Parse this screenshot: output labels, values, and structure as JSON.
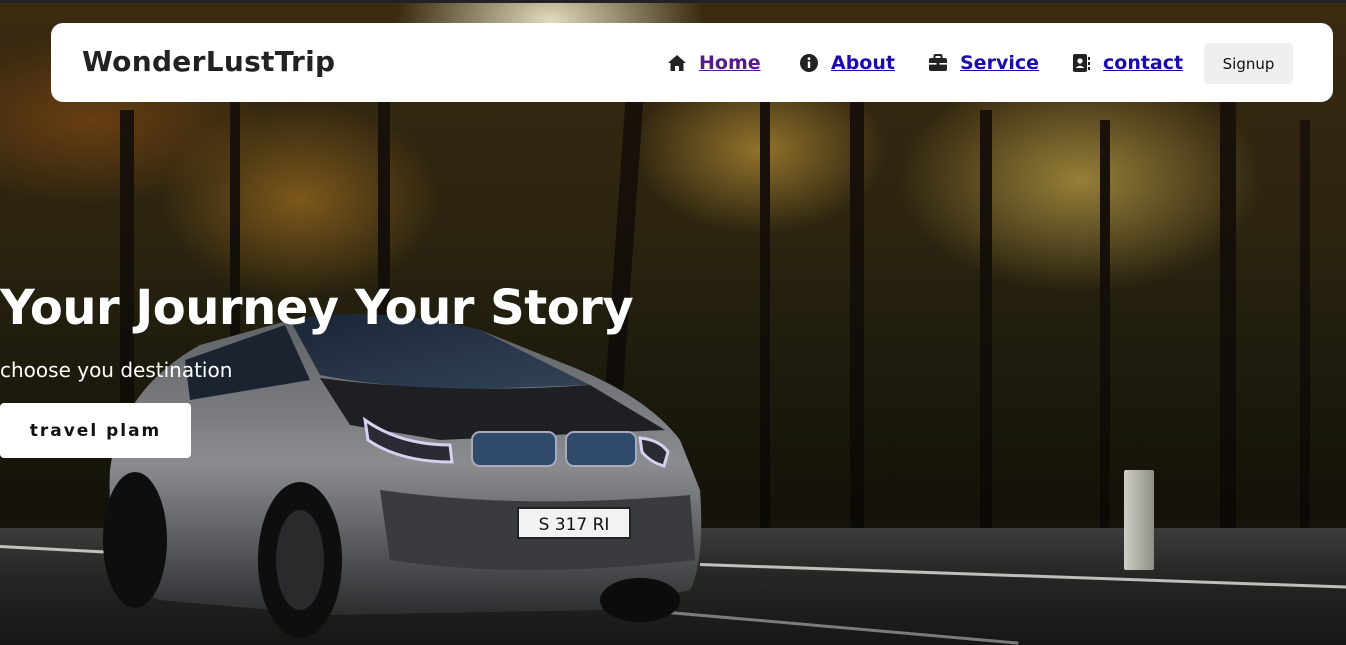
{
  "brand": "WonderLustTrip",
  "nav": {
    "items": [
      {
        "label": "Home",
        "icon": "home-icon"
      },
      {
        "label": "About",
        "icon": "info-icon"
      },
      {
        "label": "Service",
        "icon": "briefcase-icon"
      },
      {
        "label": "contact",
        "icon": "contact-book-icon"
      }
    ],
    "signup_label": "Signup"
  },
  "hero": {
    "title": "Your Journey Your Story",
    "subtitle": "choose you destination",
    "cta_label": "travel plam",
    "license_plate": "S 317 RI"
  },
  "colors": {
    "link": "#1a0dab",
    "visited_link": "#551a8b",
    "navbar_bg": "#ffffff",
    "button_bg": "#efefef"
  }
}
